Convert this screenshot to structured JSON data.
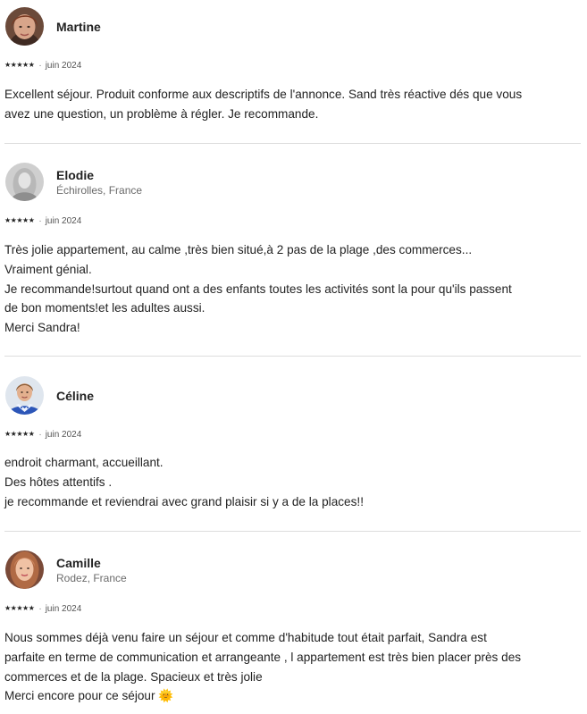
{
  "reviews": [
    {
      "name": "Martine",
      "location": "",
      "rating": 5,
      "stars": "★★★★★",
      "separator": "·",
      "date": "juin 2024",
      "lines": [
        "Excellent séjour. Produit conforme aux descriptifs de l'annonce. Sand très réactive dés que vous",
        "avez une question, un problème à régler. Je recommande."
      ],
      "avatar_icon": "avatar-photo"
    },
    {
      "name": "Elodie",
      "location": "Échirolles, France",
      "rating": 5,
      "stars": "★★★★★",
      "separator": "·",
      "date": "juin 2024",
      "lines": [
        "Très jolie appartement, au calme ,très bien situé,à 2 pas de la plage ,des commerces...",
        "Vraiment génial.",
        "Je recommande!surtout quand ont a des enfants toutes les activités sont la pour qu'ils passent",
        "de bon moments!et les adultes aussi.",
        "Merci Sandra!"
      ],
      "avatar_icon": "avatar-photo"
    },
    {
      "name": "Céline",
      "location": "",
      "rating": 5,
      "stars": "★★★★★",
      "separator": "·",
      "date": "juin 2024",
      "lines": [
        "endroit charmant, accueillant.",
        "Des hôtes attentifs .",
        "je recommande et reviendrai avec grand plaisir si y a de la places!!"
      ],
      "avatar_icon": "avatar-photo"
    },
    {
      "name": "Camille",
      "location": "Rodez, France",
      "rating": 5,
      "stars": "★★★★★",
      "separator": "·",
      "date": "juin 2024",
      "lines": [
        "Nous sommes déjà venu faire un séjour et comme d'habitude tout était parfait, Sandra est",
        "parfaite en terme de communication et arrangeante , l appartement est très bien placer près des",
        "commerces et de la plage. Spacieux et très jolie",
        "Merci encore pour ce séjour 🌞"
      ],
      "avatar_icon": "avatar-photo"
    }
  ],
  "colors": {
    "text": "#222222",
    "secondary": "#6a6a6a",
    "divider": "#dddddd"
  }
}
